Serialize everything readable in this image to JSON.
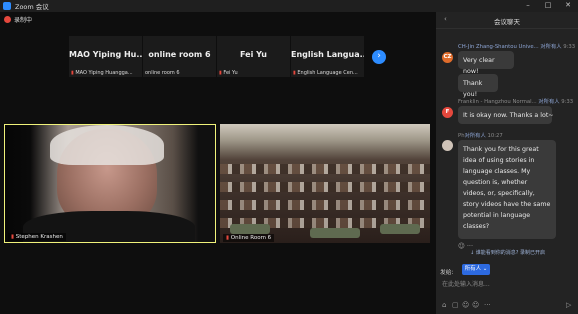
{
  "window": {
    "title": "Zoom 会议",
    "controls": [
      "–",
      "□",
      "✕"
    ]
  },
  "recording": {
    "label": "录制中"
  },
  "strip": {
    "participants": [
      {
        "name": "MAO Yiping Hu...",
        "sub": "MAO Yiping Huangga..."
      },
      {
        "name": "online room 6",
        "sub": "online room 6"
      },
      {
        "name": "Fei Yu",
        "sub": "Fei Yu"
      },
      {
        "name": "English  Langua...",
        "sub": "English Language Cen..."
      }
    ],
    "next_icon": "›"
  },
  "videos": [
    {
      "label": "Stephen Krashen"
    },
    {
      "label": "Online Room 6"
    }
  ],
  "chat": {
    "title": "会议聊天",
    "back_icon": "‹",
    "messages": [
      {
        "sender": "CH-Jin Zhang-Shantou Unive...",
        "to": "对所有人",
        "time": "9:33",
        "avatar": "CZ",
        "avatar_color": "#e06c2b",
        "text": "Very clear now!"
      },
      {
        "text": "Thank you!"
      },
      {
        "sender": "Franklin - Hangzhou Normal...",
        "to": "对所有人",
        "time": "9:33",
        "avatar": "F",
        "avatar_color": "#e5483d",
        "text": "It is okay now. Thanks a lot~"
      },
      {
        "sender": "Ph",
        "to": "对所有人",
        "time": "10:27",
        "avatar": "",
        "avatar_color": "#cfc3b8",
        "text": "Thank you for this great idea of using stories in language classes. My question is, whether videos, or, specifically, story videos have the same potential in language classes?"
      }
    ],
    "unseen": "↓ 谁能看到你的消息? 录制已开启",
    "send_to_label": "发给:",
    "recipient": "所有人 ⌄",
    "input_placeholder": "在此处输入消息...",
    "tools": [
      "⌂",
      "▢",
      "☺",
      "☺",
      "···",
      "▷"
    ],
    "emoji": "☺ ···"
  }
}
